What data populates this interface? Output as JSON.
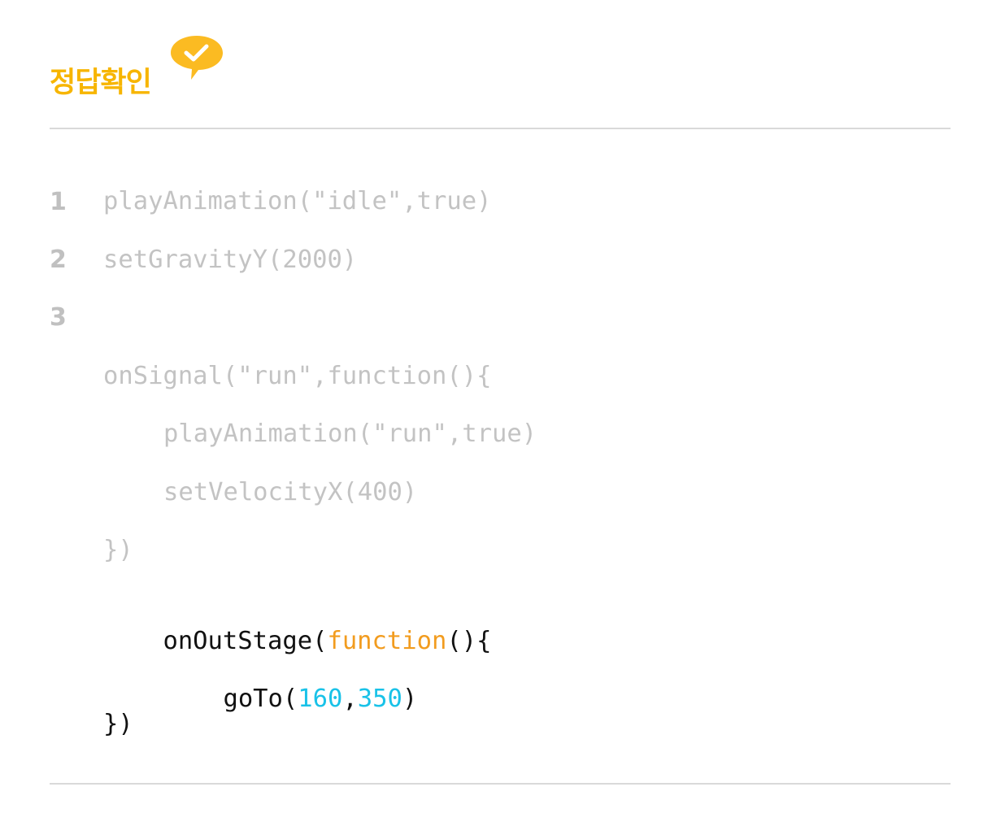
{
  "header": {
    "title": "정답확인",
    "title_color": "#f7b500",
    "icon": "check-bubble-icon",
    "icon_color": "#fbbb22"
  },
  "line_numbers": [
    "1",
    "2",
    "3"
  ],
  "code": {
    "faded_color": "#c3c3c3",
    "text_color": "#111111",
    "keyword_color": "#f29c1f",
    "number_color": "#19c2e8",
    "line1": "playAnimation(\"idle\",true)",
    "line2": "setGravityY(2000)",
    "line4": "onSignal(\"run\",function(){",
    "line5": "playAnimation(\"run\",true)",
    "line6": "setVelocityX(400)",
    "line7": "})",
    "line8": {
      "prefix": "onOutStage(",
      "keyword": "function",
      "suffix": "(){"
    },
    "line9": {
      "prefix": "goTo(",
      "arg1": "160",
      "comma": ",",
      "arg2": "350",
      "suffix": ")"
    },
    "line10": "})"
  }
}
